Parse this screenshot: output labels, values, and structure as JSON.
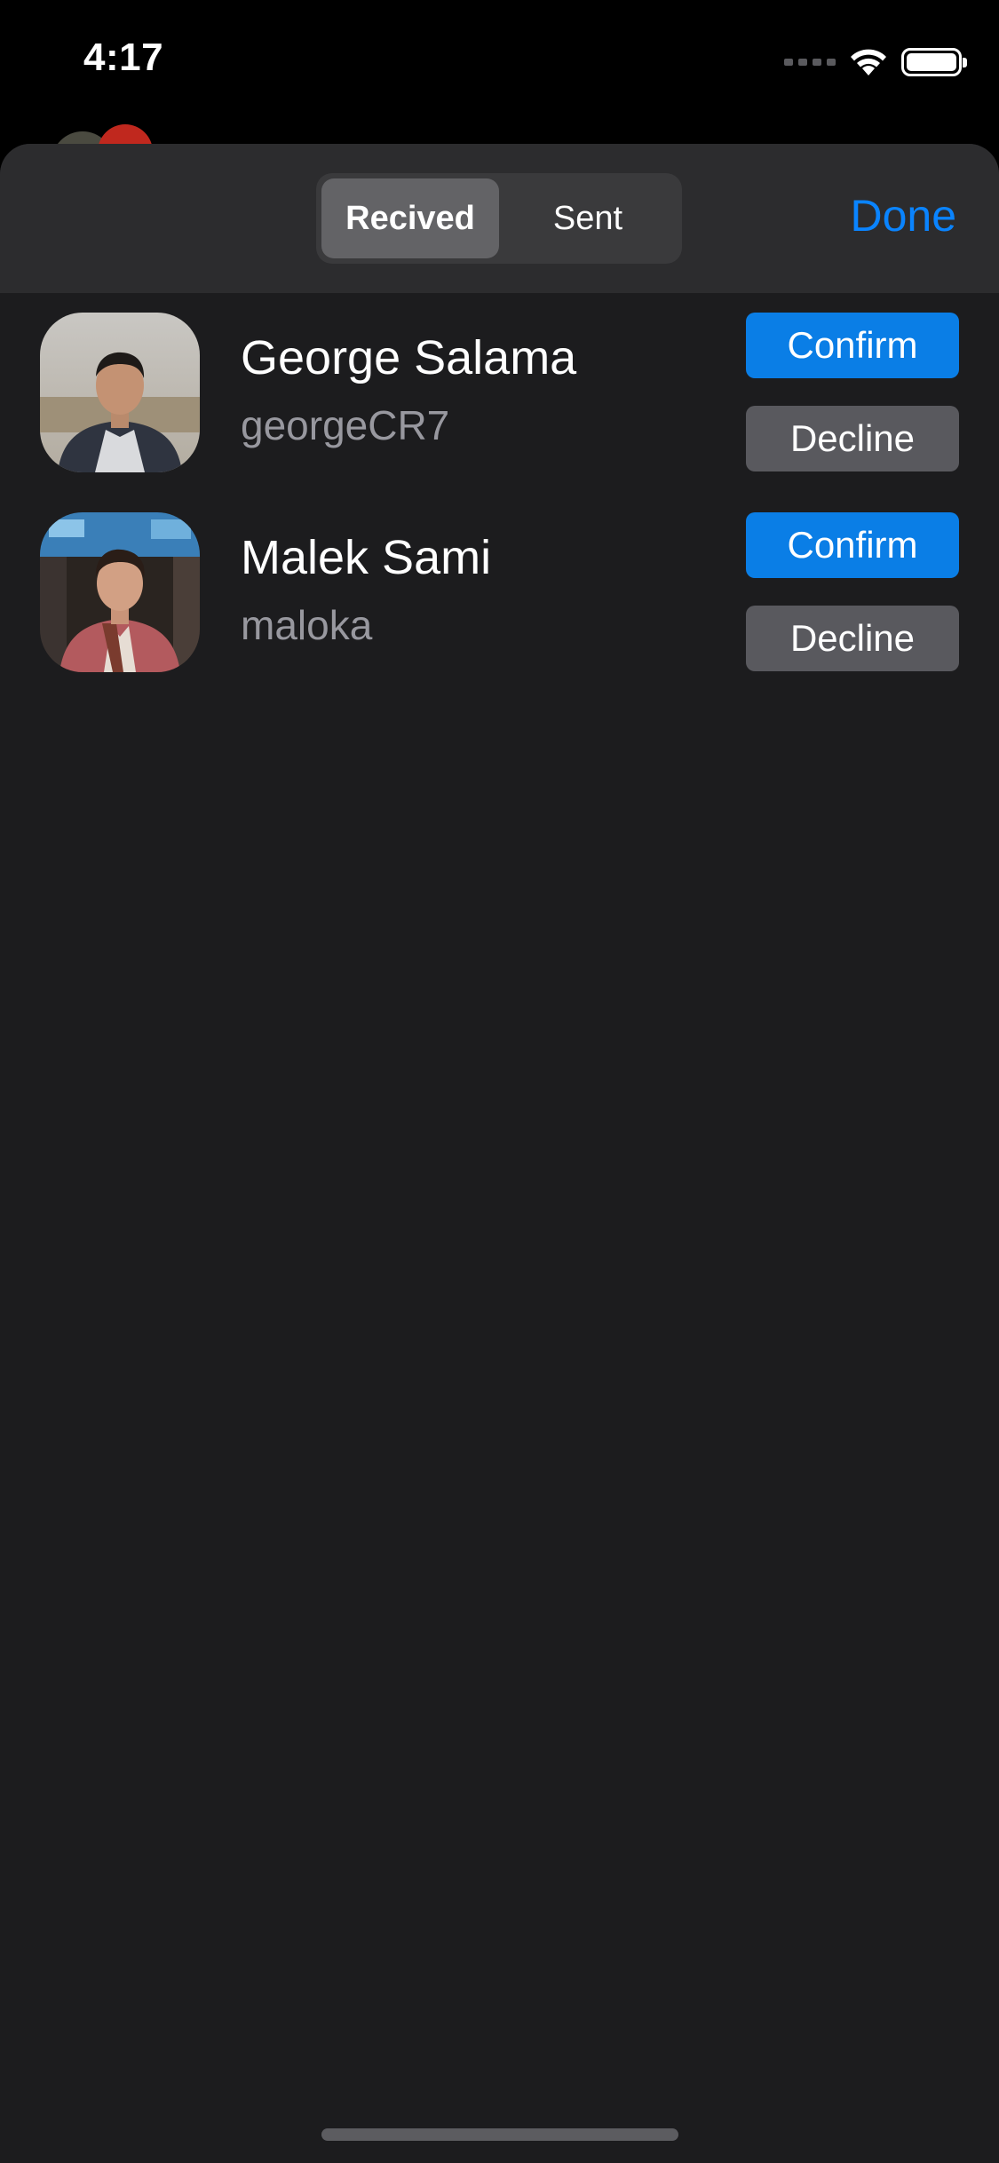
{
  "status_bar": {
    "time": "4:17"
  },
  "segmented_control": {
    "received_label": "Recived",
    "sent_label": "Sent",
    "selected": "Recived"
  },
  "header": {
    "done_label": "Done"
  },
  "requests": [
    {
      "name": "George Salama",
      "username": "georgeCR7",
      "confirm_label": "Confirm",
      "decline_label": "Decline"
    },
    {
      "name": "Malek Sami",
      "username": "maloka",
      "confirm_label": "Confirm",
      "decline_label": "Decline"
    }
  ],
  "colors": {
    "accent": "#0a84ff",
    "confirm_button": "#0a7ee6",
    "decline_button": "#59595e",
    "sheet_background": "#1c1c1e",
    "header_background": "#2c2c2e"
  },
  "icons": [
    "wifi-icon",
    "battery-icon",
    "cellular-signal-icon"
  ]
}
